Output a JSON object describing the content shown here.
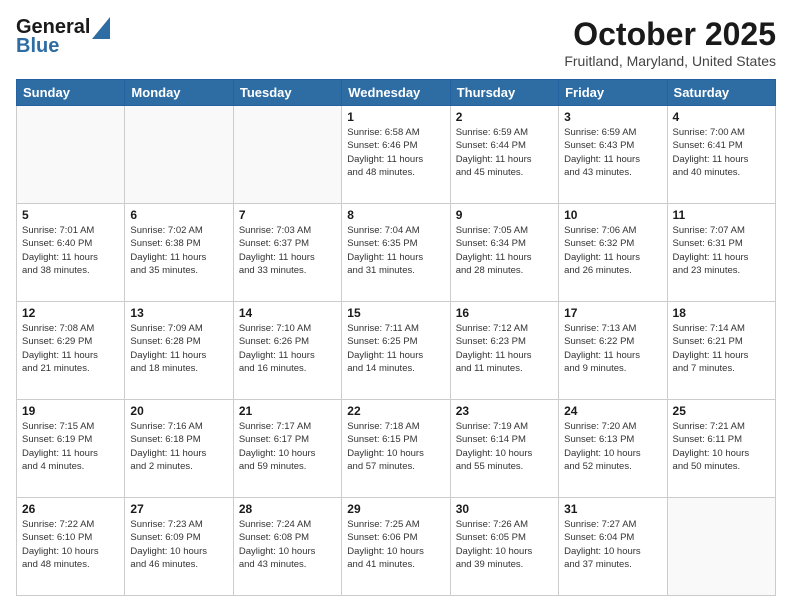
{
  "header": {
    "logo_general": "General",
    "logo_blue": "Blue",
    "title": "October 2025",
    "location": "Fruitland, Maryland, United States"
  },
  "weekdays": [
    "Sunday",
    "Monday",
    "Tuesday",
    "Wednesday",
    "Thursday",
    "Friday",
    "Saturday"
  ],
  "weeks": [
    [
      {
        "day": "",
        "info": ""
      },
      {
        "day": "",
        "info": ""
      },
      {
        "day": "",
        "info": ""
      },
      {
        "day": "1",
        "info": "Sunrise: 6:58 AM\nSunset: 6:46 PM\nDaylight: 11 hours\nand 48 minutes."
      },
      {
        "day": "2",
        "info": "Sunrise: 6:59 AM\nSunset: 6:44 PM\nDaylight: 11 hours\nand 45 minutes."
      },
      {
        "day": "3",
        "info": "Sunrise: 6:59 AM\nSunset: 6:43 PM\nDaylight: 11 hours\nand 43 minutes."
      },
      {
        "day": "4",
        "info": "Sunrise: 7:00 AM\nSunset: 6:41 PM\nDaylight: 11 hours\nand 40 minutes."
      }
    ],
    [
      {
        "day": "5",
        "info": "Sunrise: 7:01 AM\nSunset: 6:40 PM\nDaylight: 11 hours\nand 38 minutes."
      },
      {
        "day": "6",
        "info": "Sunrise: 7:02 AM\nSunset: 6:38 PM\nDaylight: 11 hours\nand 35 minutes."
      },
      {
        "day": "7",
        "info": "Sunrise: 7:03 AM\nSunset: 6:37 PM\nDaylight: 11 hours\nand 33 minutes."
      },
      {
        "day": "8",
        "info": "Sunrise: 7:04 AM\nSunset: 6:35 PM\nDaylight: 11 hours\nand 31 minutes."
      },
      {
        "day": "9",
        "info": "Sunrise: 7:05 AM\nSunset: 6:34 PM\nDaylight: 11 hours\nand 28 minutes."
      },
      {
        "day": "10",
        "info": "Sunrise: 7:06 AM\nSunset: 6:32 PM\nDaylight: 11 hours\nand 26 minutes."
      },
      {
        "day": "11",
        "info": "Sunrise: 7:07 AM\nSunset: 6:31 PM\nDaylight: 11 hours\nand 23 minutes."
      }
    ],
    [
      {
        "day": "12",
        "info": "Sunrise: 7:08 AM\nSunset: 6:29 PM\nDaylight: 11 hours\nand 21 minutes."
      },
      {
        "day": "13",
        "info": "Sunrise: 7:09 AM\nSunset: 6:28 PM\nDaylight: 11 hours\nand 18 minutes."
      },
      {
        "day": "14",
        "info": "Sunrise: 7:10 AM\nSunset: 6:26 PM\nDaylight: 11 hours\nand 16 minutes."
      },
      {
        "day": "15",
        "info": "Sunrise: 7:11 AM\nSunset: 6:25 PM\nDaylight: 11 hours\nand 14 minutes."
      },
      {
        "day": "16",
        "info": "Sunrise: 7:12 AM\nSunset: 6:23 PM\nDaylight: 11 hours\nand 11 minutes."
      },
      {
        "day": "17",
        "info": "Sunrise: 7:13 AM\nSunset: 6:22 PM\nDaylight: 11 hours\nand 9 minutes."
      },
      {
        "day": "18",
        "info": "Sunrise: 7:14 AM\nSunset: 6:21 PM\nDaylight: 11 hours\nand 7 minutes."
      }
    ],
    [
      {
        "day": "19",
        "info": "Sunrise: 7:15 AM\nSunset: 6:19 PM\nDaylight: 11 hours\nand 4 minutes."
      },
      {
        "day": "20",
        "info": "Sunrise: 7:16 AM\nSunset: 6:18 PM\nDaylight: 11 hours\nand 2 minutes."
      },
      {
        "day": "21",
        "info": "Sunrise: 7:17 AM\nSunset: 6:17 PM\nDaylight: 10 hours\nand 59 minutes."
      },
      {
        "day": "22",
        "info": "Sunrise: 7:18 AM\nSunset: 6:15 PM\nDaylight: 10 hours\nand 57 minutes."
      },
      {
        "day": "23",
        "info": "Sunrise: 7:19 AM\nSunset: 6:14 PM\nDaylight: 10 hours\nand 55 minutes."
      },
      {
        "day": "24",
        "info": "Sunrise: 7:20 AM\nSunset: 6:13 PM\nDaylight: 10 hours\nand 52 minutes."
      },
      {
        "day": "25",
        "info": "Sunrise: 7:21 AM\nSunset: 6:11 PM\nDaylight: 10 hours\nand 50 minutes."
      }
    ],
    [
      {
        "day": "26",
        "info": "Sunrise: 7:22 AM\nSunset: 6:10 PM\nDaylight: 10 hours\nand 48 minutes."
      },
      {
        "day": "27",
        "info": "Sunrise: 7:23 AM\nSunset: 6:09 PM\nDaylight: 10 hours\nand 46 minutes."
      },
      {
        "day": "28",
        "info": "Sunrise: 7:24 AM\nSunset: 6:08 PM\nDaylight: 10 hours\nand 43 minutes."
      },
      {
        "day": "29",
        "info": "Sunrise: 7:25 AM\nSunset: 6:06 PM\nDaylight: 10 hours\nand 41 minutes."
      },
      {
        "day": "30",
        "info": "Sunrise: 7:26 AM\nSunset: 6:05 PM\nDaylight: 10 hours\nand 39 minutes."
      },
      {
        "day": "31",
        "info": "Sunrise: 7:27 AM\nSunset: 6:04 PM\nDaylight: 10 hours\nand 37 minutes."
      },
      {
        "day": "",
        "info": ""
      }
    ]
  ]
}
